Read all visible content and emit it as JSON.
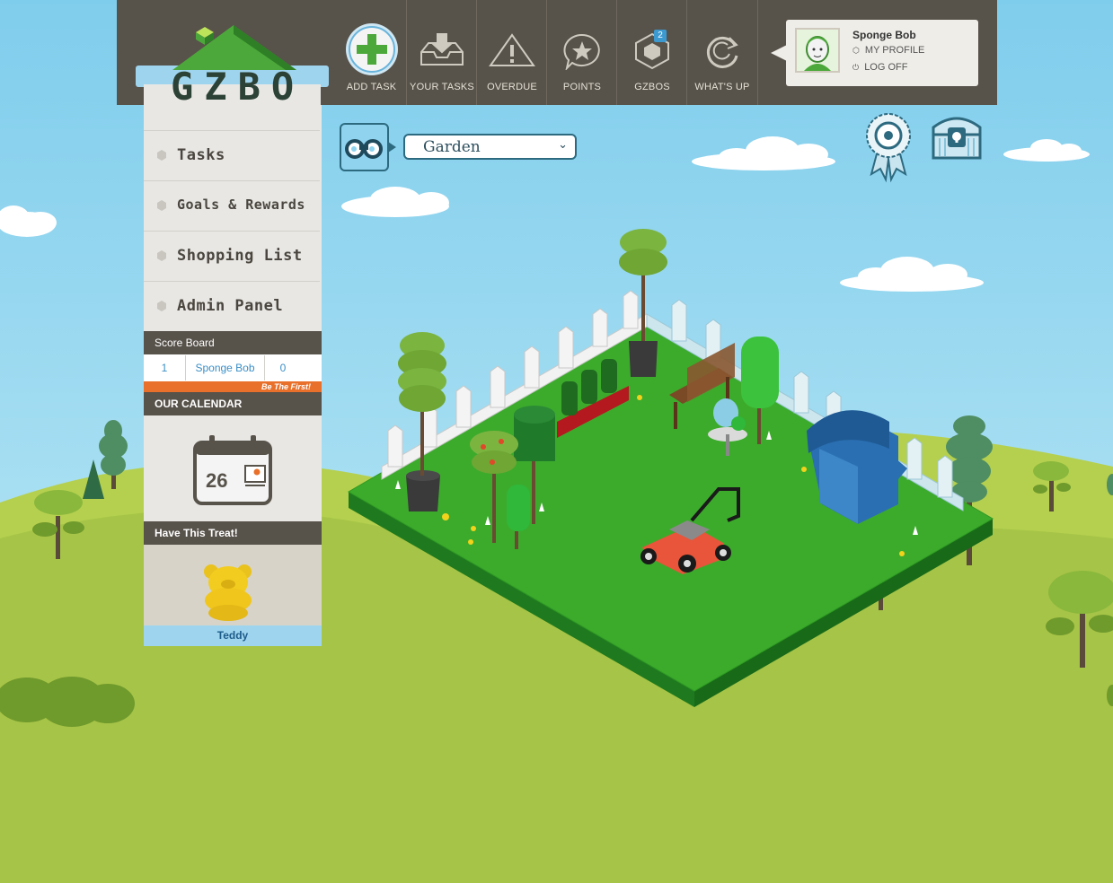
{
  "logo": {
    "text": "GZBO"
  },
  "nav": [
    {
      "label": "ADD TASK",
      "icon": "add-task-icon"
    },
    {
      "label": "YOUR TASKS",
      "icon": "inbox-download-icon"
    },
    {
      "label": "OVERDUE",
      "icon": "warning-icon"
    },
    {
      "label": "POINTS",
      "icon": "star-bubble-icon"
    },
    {
      "label": "GZBOS",
      "icon": "hexagon-icon",
      "badge": "2"
    },
    {
      "label": "WHAT'S UP",
      "icon": "refresh-icon"
    }
  ],
  "profile": {
    "name": "Sponge Bob",
    "my_profile": "MY PROFILE",
    "log_off": "LOG OFF"
  },
  "sidebar": {
    "items": [
      {
        "label": "Tasks"
      },
      {
        "label": "Goals & Rewards"
      },
      {
        "label": "Shopping List"
      },
      {
        "label": "Admin Panel"
      }
    ],
    "scoreboard": {
      "title": "Score Board",
      "rank": "1",
      "name": "Sponge Bob",
      "score": "0",
      "cta": "Be The First!"
    },
    "calendar": {
      "title": "OUR CALENDAR",
      "day": "26"
    },
    "treat": {
      "title": "Have This Treat!",
      "name": "Teddy"
    }
  },
  "room": {
    "selected": "Garden"
  },
  "colors": {
    "sky": "#8fd3ee",
    "hill": "#a6c447",
    "topbar": "#57524a",
    "accent_orange": "#e8702a",
    "link_blue": "#3b8fc6"
  }
}
